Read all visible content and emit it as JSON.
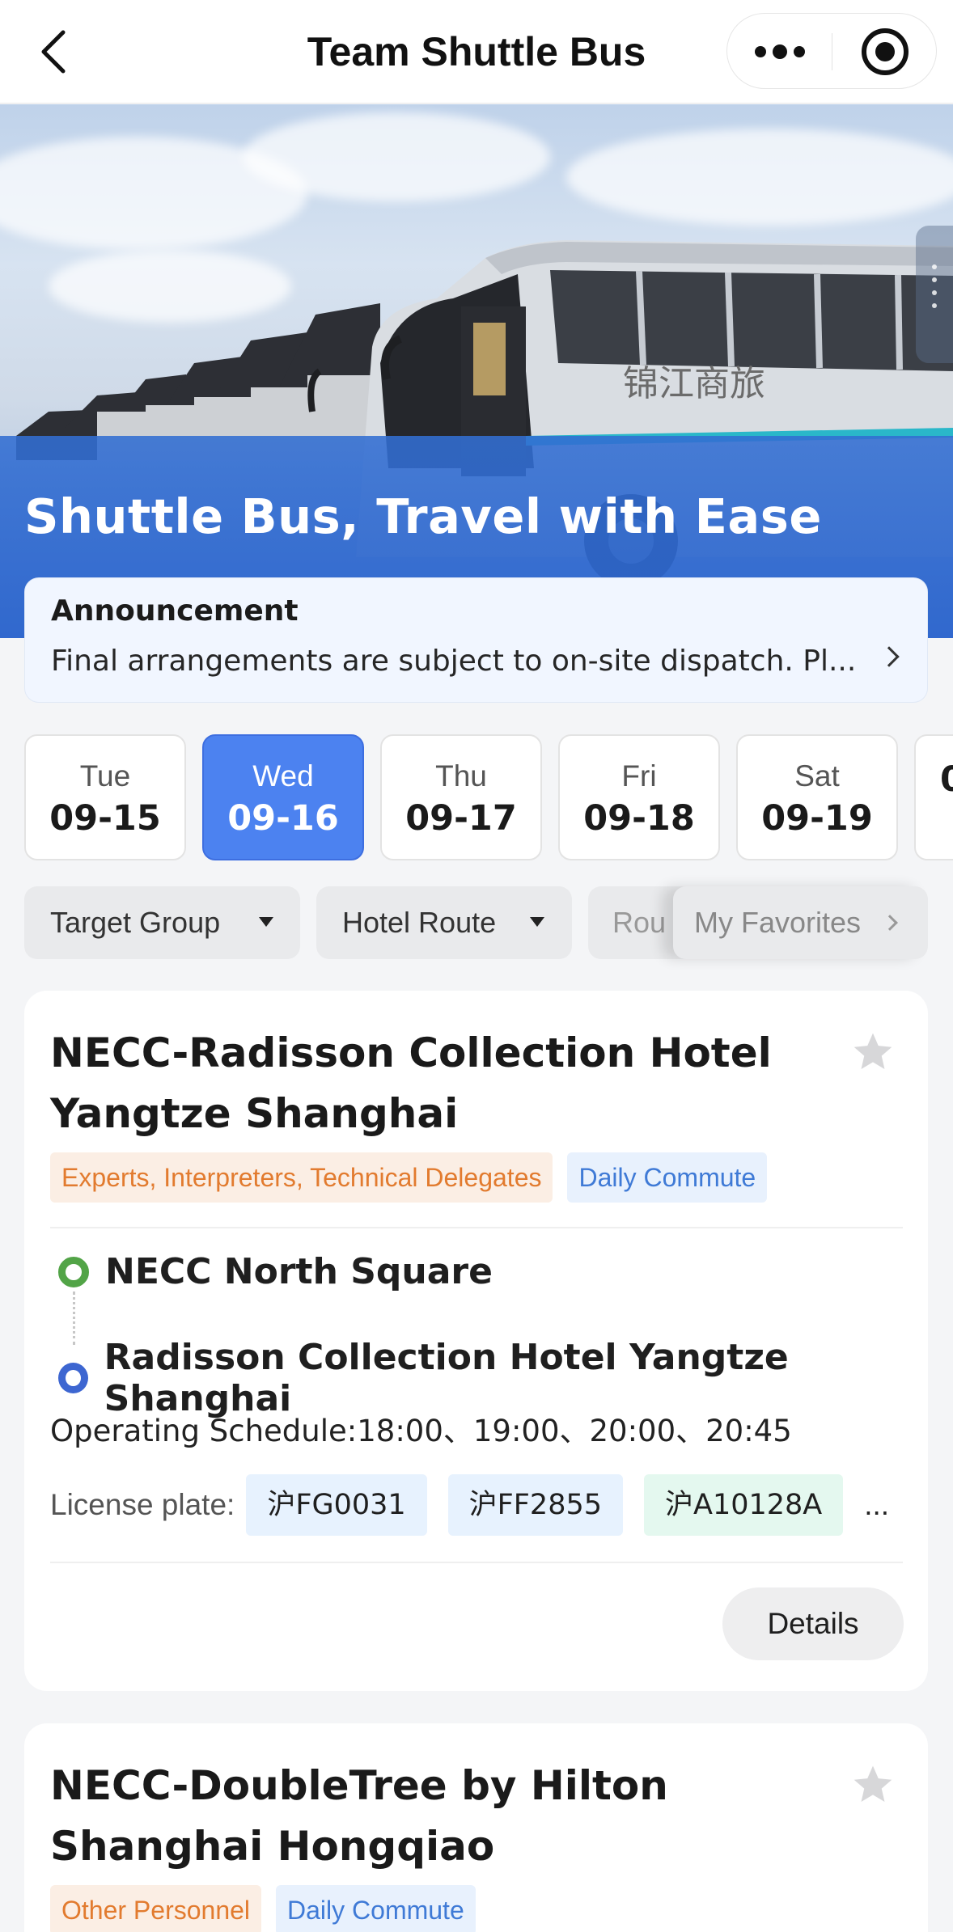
{
  "navbar": {
    "title": "Team Shuttle Bus",
    "back_icon": "chevron-left-icon",
    "more_icon": "more-dots-icon",
    "close_icon": "target-circle-icon"
  },
  "banner": {
    "headline": "Shuttle Bus, Travel with Ease",
    "bus_lettering": "锦江商旅"
  },
  "announcement": {
    "title": "Announcement",
    "text": "Final arrangements are subject to on-site dispatch. Pl..."
  },
  "dates": [
    {
      "dow": "Tue",
      "date": "09-15",
      "active": false
    },
    {
      "dow": "Wed",
      "date": "09-16",
      "active": true
    },
    {
      "dow": "Thu",
      "date": "09-17",
      "active": false
    },
    {
      "dow": "Fri",
      "date": "09-18",
      "active": false
    },
    {
      "dow": "Sat",
      "date": "09-19",
      "active": false
    },
    {
      "dow": "",
      "date": "0",
      "active": false
    }
  ],
  "filters": {
    "target_group": "Target Group",
    "hotel_route": "Hotel Route",
    "route_partial": "Rou",
    "favorites": "My Favorites"
  },
  "routes": [
    {
      "title": "NECC-Radisson Collection Hotel Yangtze Shanghai",
      "tags": [
        {
          "text": "Experts, Interpreters, Technical Delegates",
          "style": "orange"
        },
        {
          "text": "Daily Commute",
          "style": "blue"
        }
      ],
      "start": "NECC North Square",
      "end": "Radisson Collection Hotel Yangtze Shanghai",
      "schedule": "Operating Schedule:18:00、19:00、20:00、20:45",
      "plate_label": "License plate:",
      "plates": [
        "沪FG0031",
        "沪FF2855",
        "沪A10128A"
      ],
      "plates_more": "...",
      "details": "Details"
    },
    {
      "title": "NECC-DoubleTree by Hilton Shanghai Hongqiao",
      "tags": [
        {
          "text": "Other Personnel",
          "style": "orange"
        },
        {
          "text": "Daily Commute",
          "style": "blue"
        }
      ]
    }
  ],
  "colors": {
    "accent": "#4c82f0",
    "start_dot": "#52a447",
    "end_dot": "#3d66d1",
    "tag_orange": "#e27b2f",
    "tag_blue": "#3f7ad6"
  }
}
